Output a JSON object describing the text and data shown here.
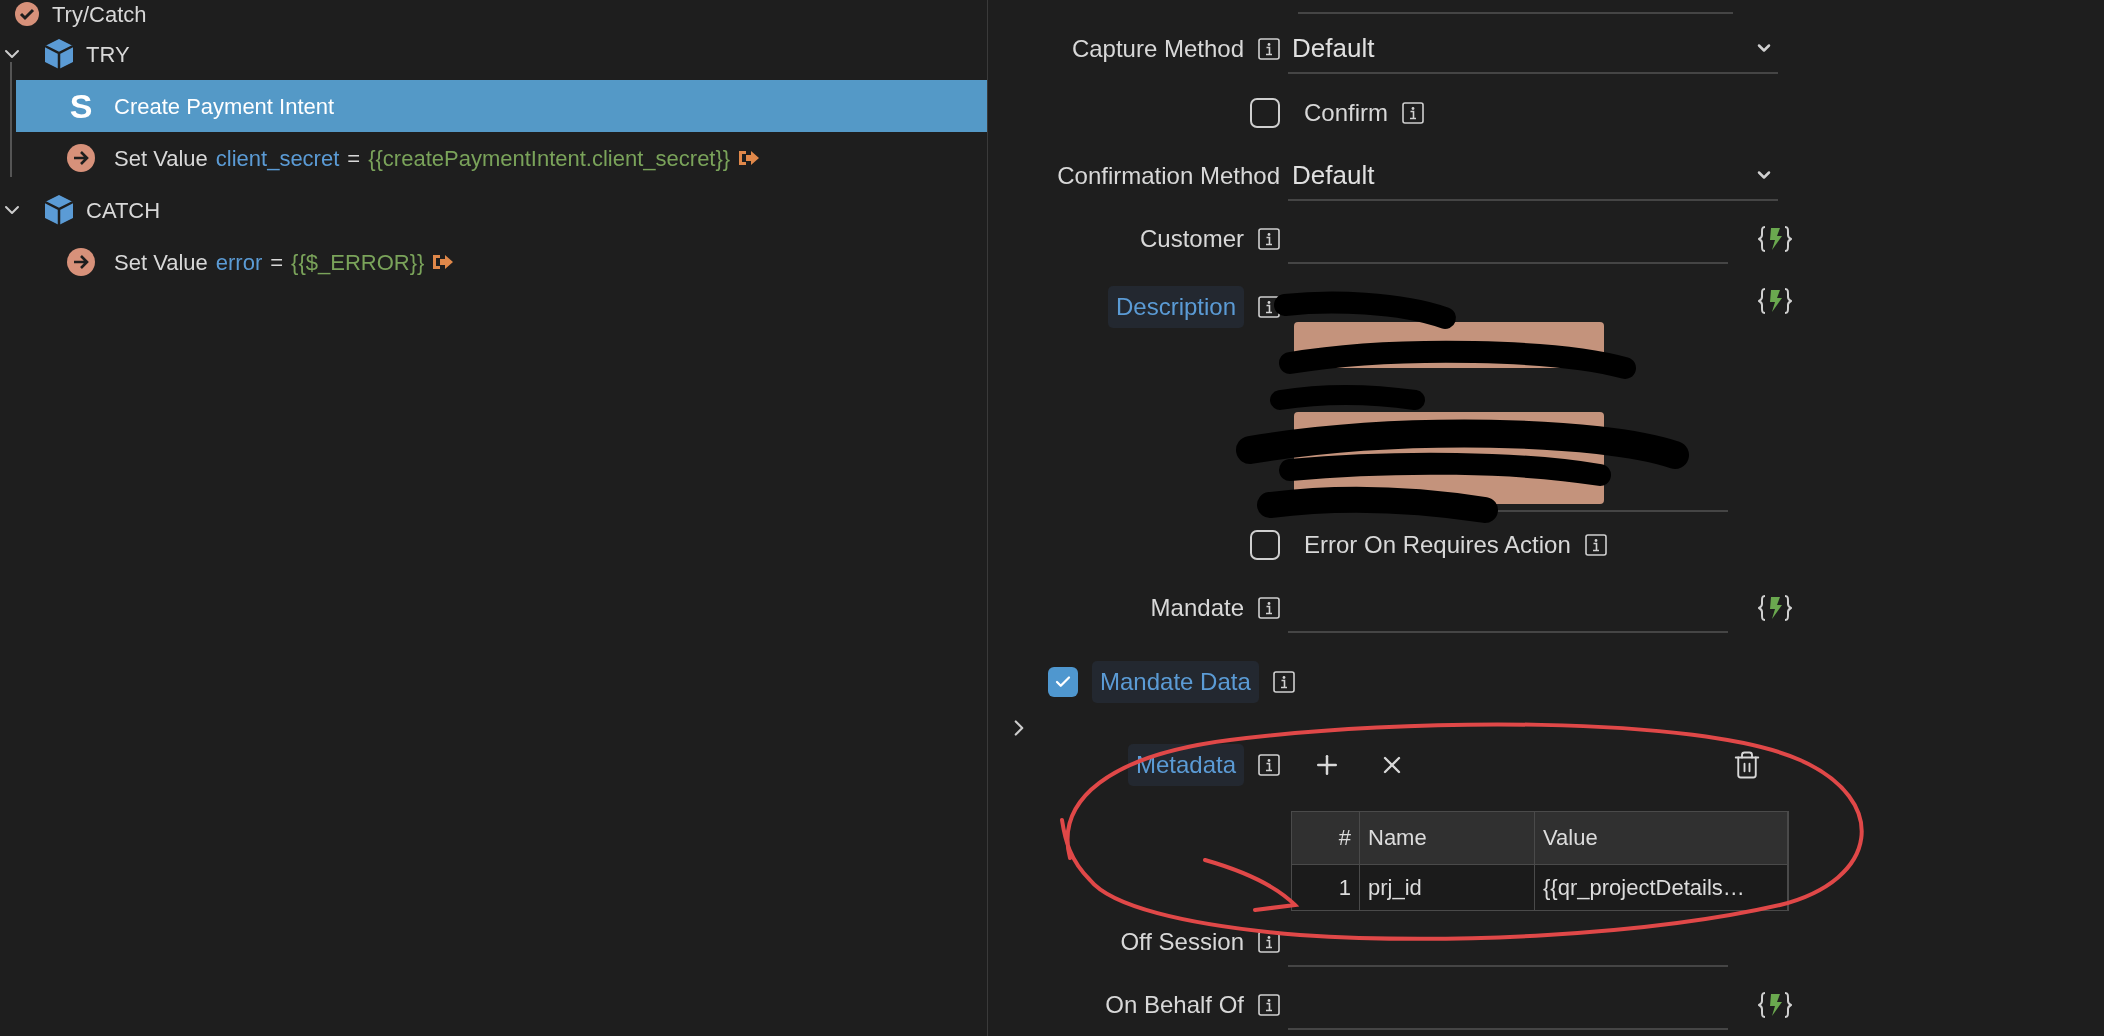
{
  "tree": {
    "label": "Try/Catch",
    "children": [
      {
        "kind": "block",
        "label": "TRY",
        "expanded": true,
        "children": [
          {
            "kind": "stripe",
            "icon_text": "S",
            "label": "Create Payment Intent",
            "selected": true
          },
          {
            "kind": "setvalue",
            "label": "Set Value",
            "variable": "client_secret",
            "operator": "=",
            "expression": "{{createPaymentIntent.client_secret}}",
            "selected": false
          }
        ]
      },
      {
        "kind": "block",
        "label": "CATCH",
        "expanded": true,
        "children": [
          {
            "kind": "setvalue",
            "label": "Set Value",
            "variable": "error",
            "operator": "=",
            "expression": "{{$_ERROR}}",
            "selected": false
          }
        ]
      }
    ]
  },
  "form": [
    {
      "kind": "select",
      "label": "Capture Method",
      "info": true,
      "value": "Default"
    },
    {
      "kind": "checkbox",
      "label": "Confirm",
      "checked": false
    },
    {
      "kind": "select",
      "label": "Confirmation Method",
      "info": false,
      "value": "Default"
    },
    {
      "kind": "text",
      "label": "Customer",
      "highlighted": false
    },
    {
      "kind": "description",
      "label": "Description",
      "highlighted": true
    },
    {
      "kind": "checkbox",
      "label": "Error On Requires Action",
      "checked": false
    },
    {
      "kind": "text",
      "label": "Mandate",
      "highlighted": false
    },
    {
      "kind": "section",
      "label": "Mandate Data",
      "checked": true
    },
    {
      "kind": "metadata",
      "label": "Metadata",
      "expanded": false,
      "columns": [
        "#",
        "Name",
        "Value"
      ],
      "rows": [
        [
          "1",
          "prj_id",
          "{{qr_projectDetails…"
        ]
      ]
    },
    {
      "kind": "plain",
      "label": "Off Session"
    },
    {
      "kind": "text",
      "label": "On Behalf Of",
      "highlighted": false
    }
  ]
}
